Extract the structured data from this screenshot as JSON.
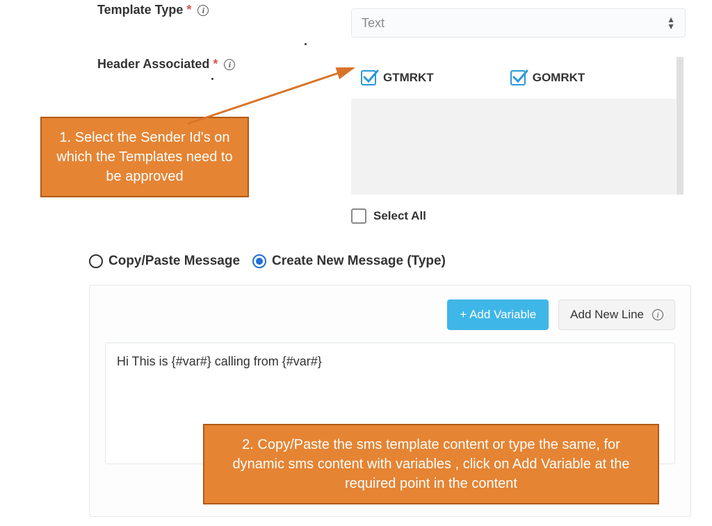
{
  "fields": {
    "template_type": {
      "label": "Template Type",
      "value": "Text"
    },
    "header_associated": {
      "label": "Header Associated",
      "options": [
        {
          "name": "GTMRKT",
          "checked": true
        },
        {
          "name": "GOMRKT",
          "checked": true
        }
      ],
      "select_all_label": "Select All"
    }
  },
  "message_mode": {
    "copy_paste": "Copy/Paste Message",
    "create_new": "Create New Message (Type)",
    "selected": "create_new"
  },
  "editor": {
    "add_variable": "+ Add Variable",
    "add_new_line": "Add New Line",
    "content": "Hi This is {#var#} calling from {#var#}"
  },
  "callouts": {
    "c1": "1. Select the Sender Id's on which the Templates need to be approved",
    "c2": "2. Copy/Paste the sms template content or type the same, for dynamic sms content with variables , click on Add Variable at the required point in the content"
  }
}
